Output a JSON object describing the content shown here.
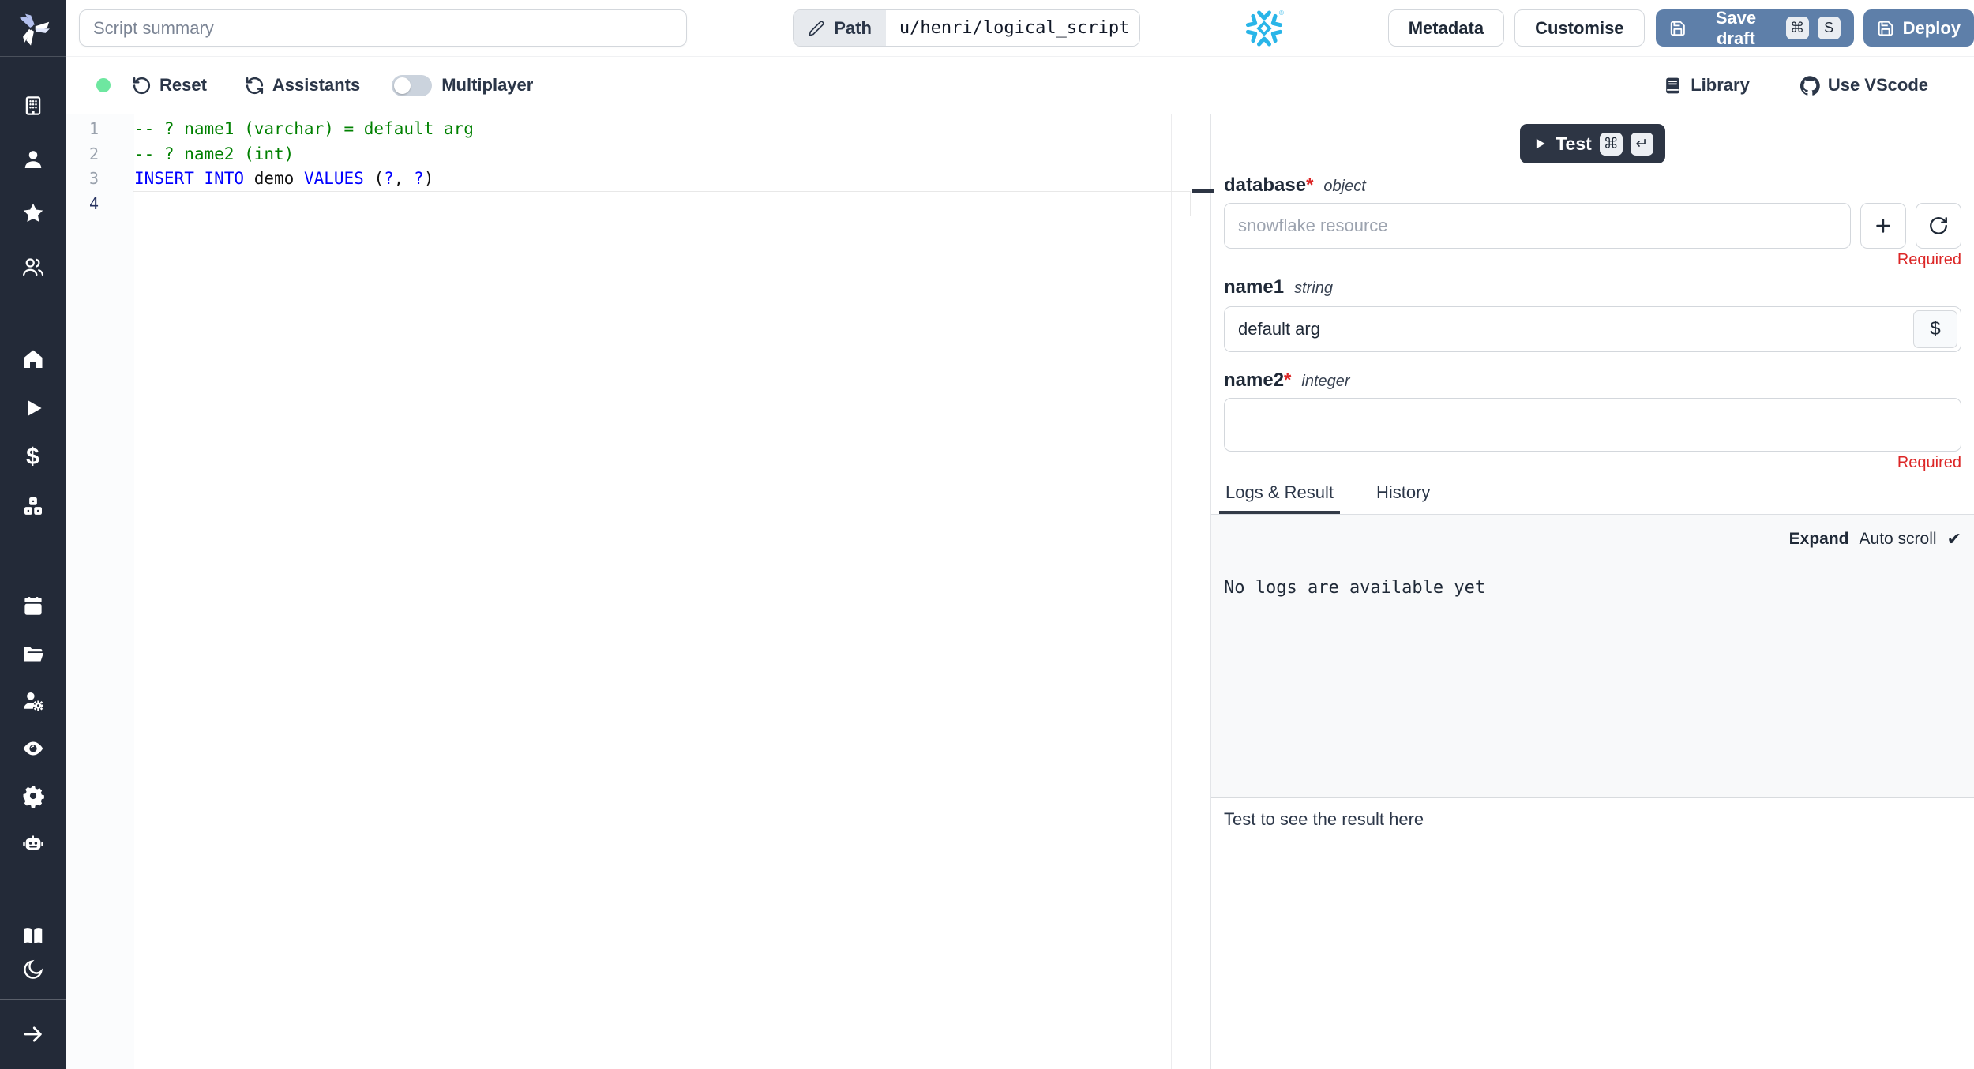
{
  "colors": {
    "sidebar_bg": "#232a38",
    "primary_button_blue": "#5e7fa9",
    "dark_button": "#2d3544",
    "status_green": "#6ee7a0",
    "required_red": "#dc2626",
    "snowflake_blue": "#29b5e8",
    "code_comment_green": "#008000",
    "code_keyword_blue": "#0000ff"
  },
  "icons": {
    "command_key": "⌘",
    "return_key": "↵",
    "check_mark": "✔",
    "dollar": "$",
    "registered": "®"
  },
  "topbar": {
    "summary_placeholder": "Script summary",
    "path_label": "Path",
    "path_value": "u/henri/logical_script",
    "metadata_label": "Metadata",
    "customise_label": "Customise",
    "save_draft_label": "Save draft",
    "save_keys": [
      "⌘",
      "S"
    ],
    "deploy_label": "Deploy"
  },
  "toolbar": {
    "reset_label": "Reset",
    "assistants_label": "Assistants",
    "multiplayer_label": "Multiplayer",
    "library_label": "Library",
    "vscode_label": "Use VScode"
  },
  "sidebar": {
    "items": [
      "building",
      "user",
      "star",
      "users",
      "home",
      "play",
      "dollar",
      "cubes",
      "calendar",
      "folder-open",
      "user-gear",
      "eye",
      "gear",
      "robot"
    ],
    "bottom_items": [
      "book-open",
      "moon",
      "arrow-right"
    ]
  },
  "editor": {
    "lines": [
      {
        "n": "1",
        "active": false,
        "parts": [
          {
            "t": "-- ? name1 (varchar) = default arg",
            "s": "c"
          }
        ]
      },
      {
        "n": "2",
        "active": false,
        "parts": [
          {
            "t": "-- ? name2 (int)",
            "s": "c"
          }
        ]
      },
      {
        "n": "3",
        "active": false,
        "parts": [
          {
            "t": "INSERT INTO",
            "s": "k"
          },
          {
            "t": " demo ",
            "s": "p"
          },
          {
            "t": "VALUES",
            "s": "k"
          },
          {
            "t": " (",
            "s": "p"
          },
          {
            "t": "?",
            "s": "k"
          },
          {
            "t": ", ",
            "s": "p"
          },
          {
            "t": "?",
            "s": "k"
          },
          {
            "t": ")",
            "s": "p"
          }
        ]
      },
      {
        "n": "4",
        "active": true,
        "parts": []
      }
    ]
  },
  "run_panel": {
    "test_label": "Test",
    "test_keys": [
      "⌘",
      "↵"
    ],
    "fields": [
      {
        "name": "database",
        "required": "*",
        "type": "object",
        "placeholder": "snowflake resource",
        "required_msg": "Required"
      },
      {
        "name": "name1",
        "required": "",
        "type": "string",
        "value": "default arg",
        "expr_button": "$"
      },
      {
        "name": "name2",
        "required": "*",
        "type": "integer",
        "value": "",
        "required_msg": "Required"
      }
    ],
    "tabs": [
      {
        "label": "Logs & Result"
      },
      {
        "label": "History"
      }
    ],
    "logs": {
      "expand_label": "Expand",
      "autoscroll_label": "Auto scroll",
      "check": "✔",
      "empty_text": "No logs are available yet"
    },
    "result": {
      "empty_text": "Test to see the result here"
    }
  }
}
